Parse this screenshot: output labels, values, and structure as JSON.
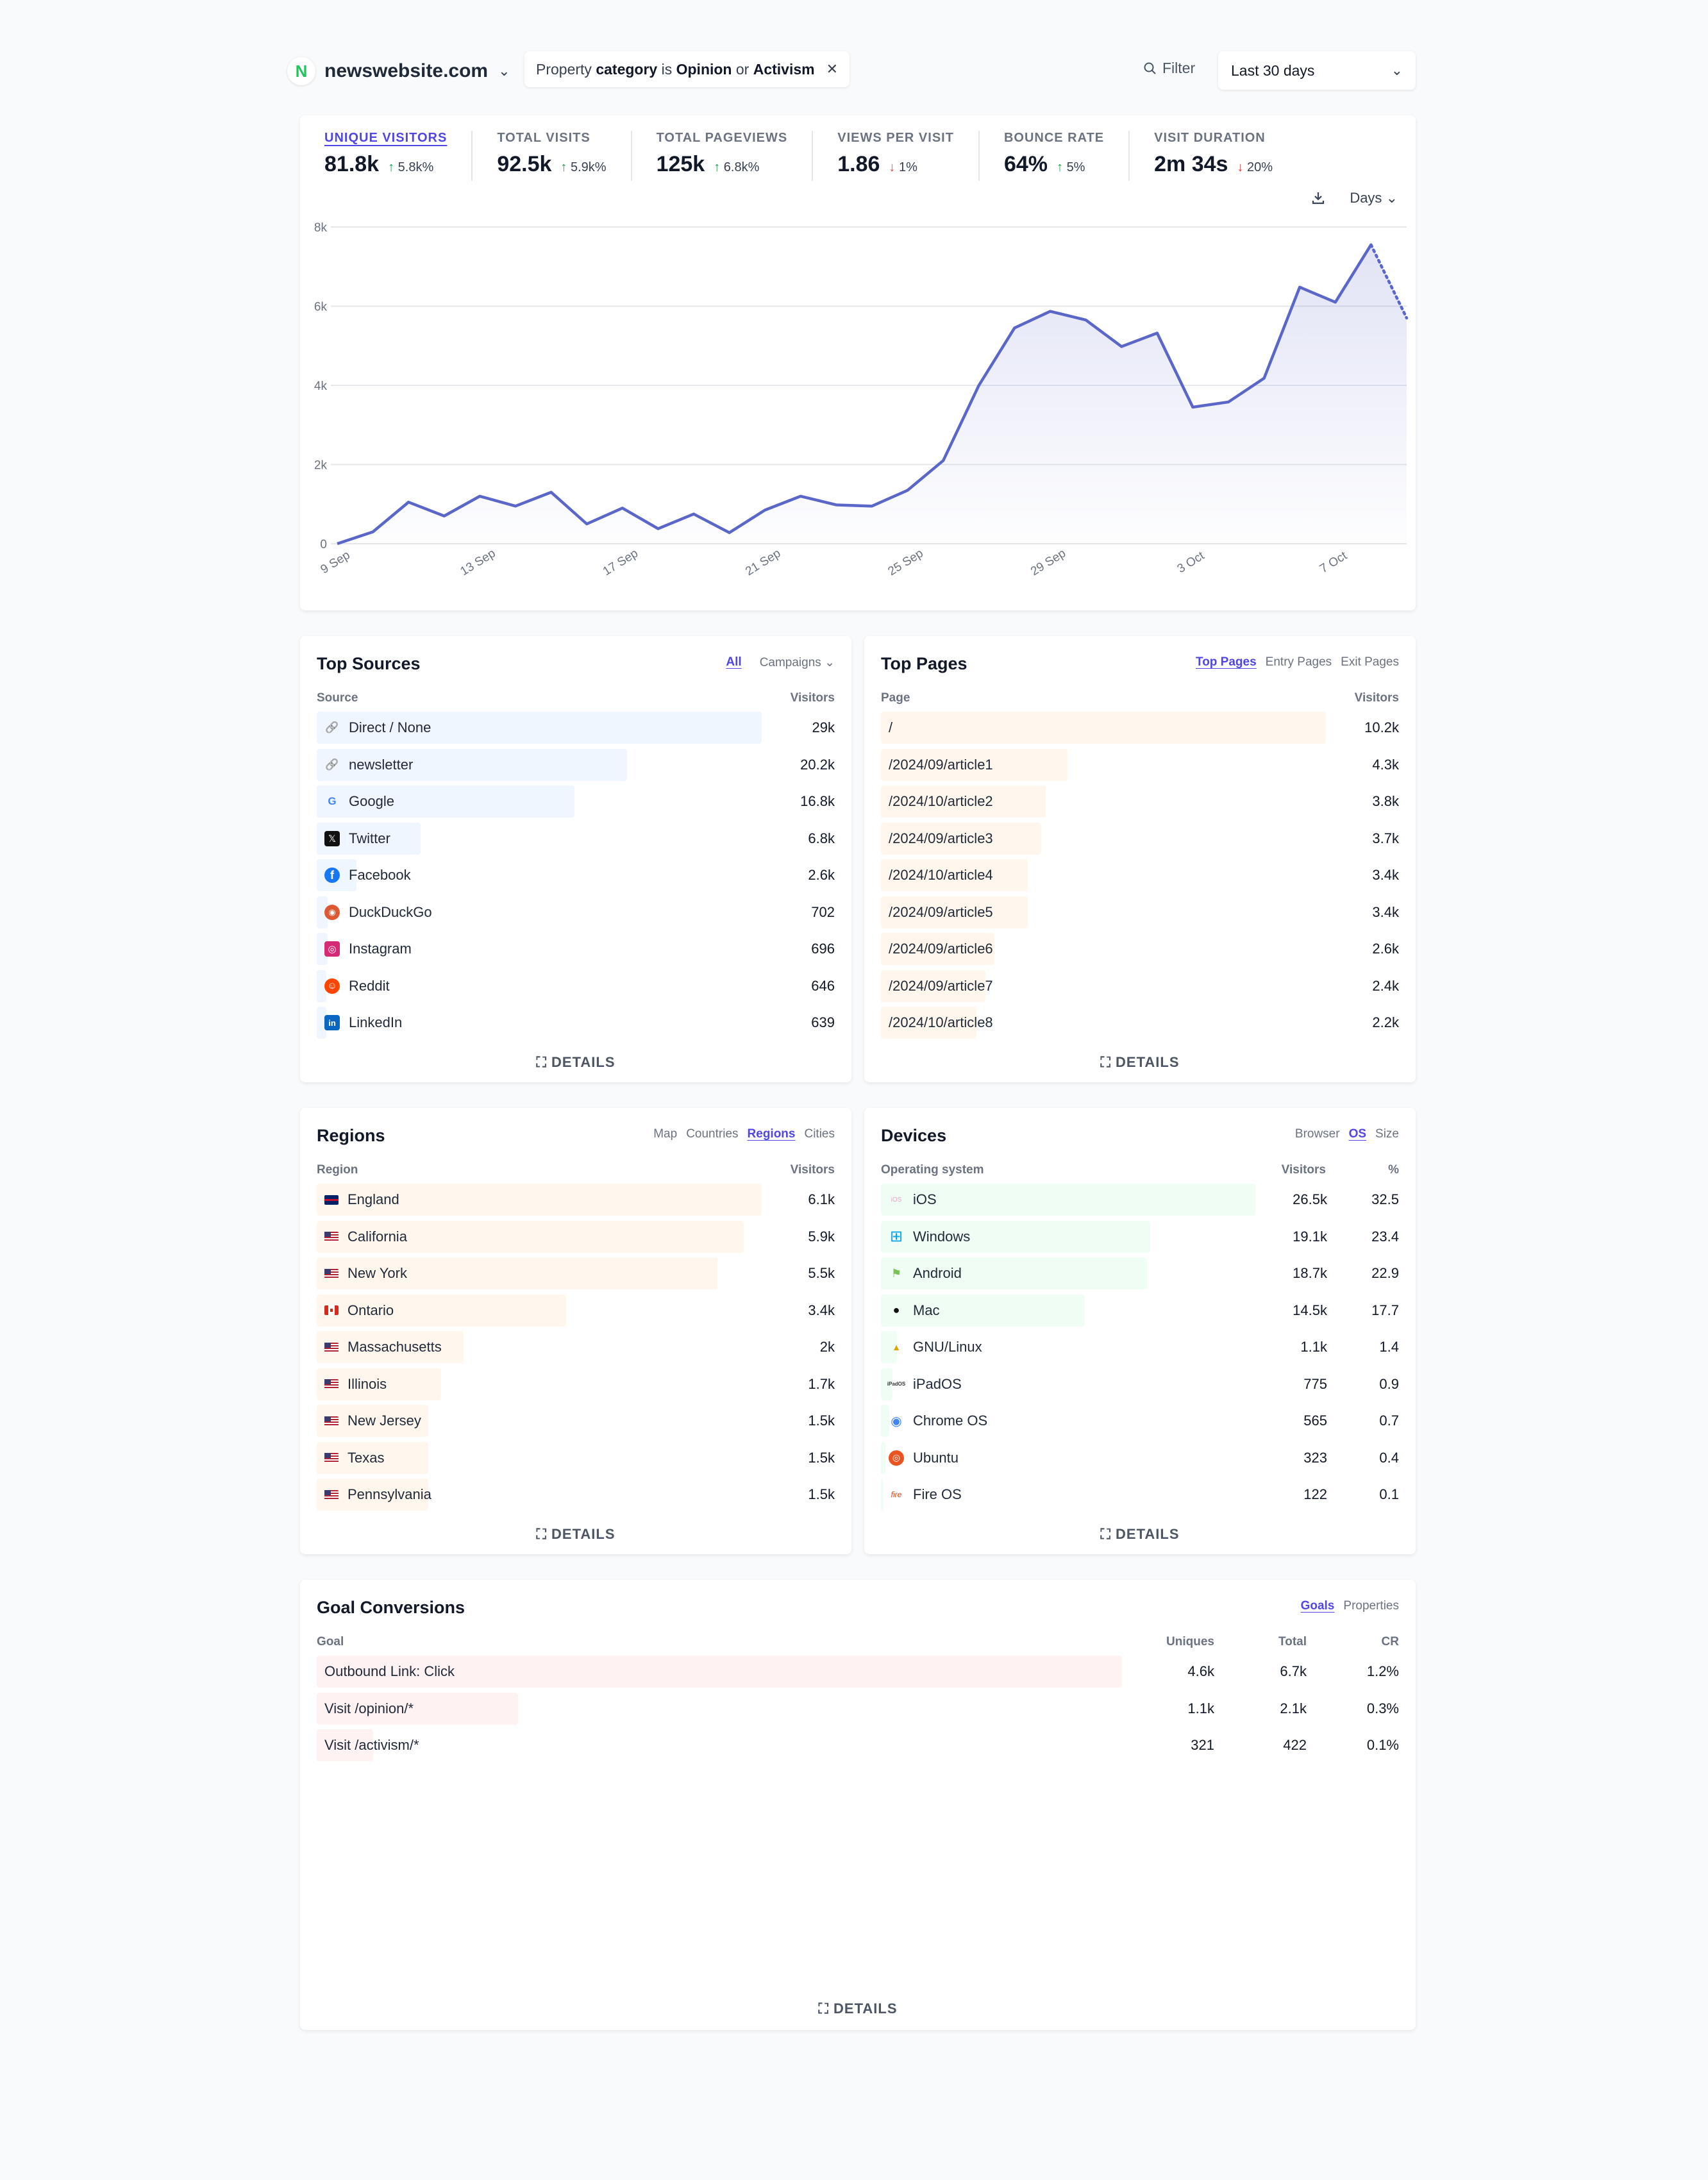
{
  "site": {
    "initial": "N",
    "domain": "newswebsite.com"
  },
  "filter": {
    "prefix": "Property",
    "property": "category",
    "verb": "is",
    "value1": "Opinion",
    "joiner": "or",
    "value2": "Activism"
  },
  "filter_button": "Filter",
  "period": "Last 30 days",
  "stats": [
    {
      "label": "UNIQUE VISITORS",
      "value": "81.8k",
      "change": "5.8k%",
      "dir": "up"
    },
    {
      "label": "TOTAL VISITS",
      "value": "92.5k",
      "change": "5.9k%",
      "dir": "up"
    },
    {
      "label": "TOTAL PAGEVIEWS",
      "value": "125k",
      "change": "6.8k%",
      "dir": "up"
    },
    {
      "label": "VIEWS PER VISIT",
      "value": "1.86",
      "change": "1%",
      "dir": "down"
    },
    {
      "label": "BOUNCE RATE",
      "value": "64%",
      "change": "5%",
      "dir": "up"
    },
    {
      "label": "VISIT DURATION",
      "value": "2m 34s",
      "change": "20%",
      "dir": "down"
    }
  ],
  "interval": "Days",
  "chart_data": {
    "type": "area",
    "ylim": [
      0,
      8000
    ],
    "yticks": [
      0,
      2000,
      4000,
      6000,
      8000
    ],
    "ytick_labels": [
      "0",
      "2k",
      "4k",
      "6k",
      "8k"
    ],
    "xtick_labels": [
      "9 Sep",
      "13 Sep",
      "17 Sep",
      "21 Sep",
      "25 Sep",
      "29 Sep",
      "3 Oct",
      "7 Oct"
    ],
    "x": [
      "9 Sep",
      "10 Sep",
      "11 Sep",
      "12 Sep",
      "13 Sep",
      "14 Sep",
      "15 Sep",
      "16 Sep",
      "17 Sep",
      "18 Sep",
      "19 Sep",
      "20 Sep",
      "21 Sep",
      "22 Sep",
      "23 Sep",
      "24 Sep",
      "25 Sep",
      "26 Sep",
      "27 Sep",
      "28 Sep",
      "29 Sep",
      "30 Sep",
      "1 Oct",
      "2 Oct",
      "3 Oct",
      "4 Oct",
      "5 Oct",
      "6 Oct",
      "7 Oct",
      "8 Oct",
      "9 Oct",
      "10 Oct"
    ],
    "series": [
      {
        "values": [
          0,
          300,
          1050,
          700,
          1200,
          950,
          1300,
          500,
          900,
          380,
          750,
          280,
          850,
          1200,
          980,
          950,
          1350,
          2100,
          4000,
          5450,
          5870,
          5650,
          4980,
          5320,
          3450,
          3580,
          4180,
          6480,
          6100,
          7550,
          5700
        ]
      }
    ],
    "grid": true,
    "color": "#5b66c9",
    "incomplete_last_segment": true
  },
  "top_sources": {
    "title": "Top Sources",
    "tabs": [
      "All",
      "Campaigns"
    ],
    "col_left": "Source",
    "col_right": "Visitors",
    "rows": [
      {
        "label": "Direct / None",
        "value": "29k",
        "frac": 1.0,
        "icon": "link-icon"
      },
      {
        "label": "newsletter",
        "value": "20.2k",
        "frac": 0.697,
        "icon": "link-icon"
      },
      {
        "label": "Google",
        "value": "16.8k",
        "frac": 0.579,
        "icon": "google-icon"
      },
      {
        "label": "Twitter",
        "value": "6.8k",
        "frac": 0.234,
        "icon": "x-icon"
      },
      {
        "label": "Facebook",
        "value": "2.6k",
        "frac": 0.09,
        "icon": "facebook-icon"
      },
      {
        "label": "DuckDuckGo",
        "value": "702",
        "frac": 0.024,
        "icon": "duckduckgo-icon"
      },
      {
        "label": "Instagram",
        "value": "696",
        "frac": 0.024,
        "icon": "instagram-icon"
      },
      {
        "label": "Reddit",
        "value": "646",
        "frac": 0.022,
        "icon": "reddit-icon"
      },
      {
        "label": "LinkedIn",
        "value": "639",
        "frac": 0.022,
        "icon": "linkedin-icon"
      }
    ],
    "details": "DETAILS"
  },
  "top_pages": {
    "title": "Top Pages",
    "tabs": [
      "Top Pages",
      "Entry Pages",
      "Exit Pages"
    ],
    "col_left": "Page",
    "col_right": "Visitors",
    "rows": [
      {
        "label": "/",
        "value": "10.2k",
        "frac": 1.0
      },
      {
        "label": "/2024/09/article1",
        "value": "4.3k",
        "frac": 0.42
      },
      {
        "label": "/2024/10/article2",
        "value": "3.8k",
        "frac": 0.37
      },
      {
        "label": "/2024/09/article3",
        "value": "3.7k",
        "frac": 0.36
      },
      {
        "label": "/2024/10/article4",
        "value": "3.4k",
        "frac": 0.33
      },
      {
        "label": "/2024/09/article5",
        "value": "3.4k",
        "frac": 0.33
      },
      {
        "label": "/2024/09/article6",
        "value": "2.6k",
        "frac": 0.255
      },
      {
        "label": "/2024/09/article7",
        "value": "2.4k",
        "frac": 0.235
      },
      {
        "label": "/2024/10/article8",
        "value": "2.2k",
        "frac": 0.215
      }
    ],
    "details": "DETAILS"
  },
  "regions": {
    "title": "Regions",
    "tabs": [
      "Map",
      "Countries",
      "Regions",
      "Cities"
    ],
    "col_left": "Region",
    "col_right": "Visitors",
    "rows": [
      {
        "label": "England",
        "value": "6.1k",
        "frac": 1.0,
        "flag": "gb"
      },
      {
        "label": "California",
        "value": "5.9k",
        "frac": 0.96,
        "flag": "us"
      },
      {
        "label": "New York",
        "value": "5.5k",
        "frac": 0.9,
        "flag": "us"
      },
      {
        "label": "Ontario",
        "value": "3.4k",
        "frac": 0.56,
        "flag": "ca"
      },
      {
        "label": "Massachusetts",
        "value": "2k",
        "frac": 0.33,
        "flag": "us"
      },
      {
        "label": "Illinois",
        "value": "1.7k",
        "frac": 0.28,
        "flag": "us"
      },
      {
        "label": "New Jersey",
        "value": "1.5k",
        "frac": 0.25,
        "flag": "us"
      },
      {
        "label": "Texas",
        "value": "1.5k",
        "frac": 0.25,
        "flag": "us"
      },
      {
        "label": "Pennsylvania",
        "value": "1.5k",
        "frac": 0.25,
        "flag": "us"
      }
    ],
    "details": "DETAILS"
  },
  "devices": {
    "title": "Devices",
    "tabs": [
      "Browser",
      "OS",
      "Size"
    ],
    "col_left": "Operating system",
    "col_mid": "Visitors",
    "col_right": "%",
    "rows": [
      {
        "label": "iOS",
        "value": "26.5k",
        "pct": "32.5",
        "frac": 1.0,
        "icon": "ios-icon"
      },
      {
        "label": "Windows",
        "value": "19.1k",
        "pct": "23.4",
        "frac": 0.72,
        "icon": "windows-icon"
      },
      {
        "label": "Android",
        "value": "18.7k",
        "pct": "22.9",
        "frac": 0.71,
        "icon": "android-icon"
      },
      {
        "label": "Mac",
        "value": "14.5k",
        "pct": "17.7",
        "frac": 0.545,
        "icon": "apple-icon"
      },
      {
        "label": "GNU/Linux",
        "value": "1.1k",
        "pct": "1.4",
        "frac": 0.042,
        "icon": "linux-icon"
      },
      {
        "label": "iPadOS",
        "value": "775",
        "pct": "0.9",
        "frac": 0.03,
        "icon": "ipados-icon"
      },
      {
        "label": "Chrome OS",
        "value": "565",
        "pct": "0.7",
        "frac": 0.022,
        "icon": "chrome-icon"
      },
      {
        "label": "Ubuntu",
        "value": "323",
        "pct": "0.4",
        "frac": 0.012,
        "icon": "ubuntu-icon"
      },
      {
        "label": "Fire OS",
        "value": "122",
        "pct": "0.1",
        "frac": 0.005,
        "icon": "fire-icon"
      }
    ],
    "details": "DETAILS"
  },
  "goals": {
    "title": "Goal Conversions",
    "tabs": [
      "Goals",
      "Properties"
    ],
    "col_left": "Goal",
    "col_uniques": "Uniques",
    "col_total": "Total",
    "col_cr": "CR",
    "rows": [
      {
        "label": "Outbound Link: Click",
        "uniques": "4.6k",
        "total": "6.7k",
        "cr": "1.2%",
        "frac": 1.0
      },
      {
        "label": "Visit /opinion/*",
        "uniques": "1.1k",
        "total": "2.1k",
        "cr": "0.3%",
        "frac": 0.25
      },
      {
        "label": "Visit /activism/*",
        "uniques": "321",
        "total": "422",
        "cr": "0.1%",
        "frac": 0.07
      }
    ],
    "details": "DETAILS"
  },
  "colors": {
    "accent": "#4f46e5",
    "line": "#5b66c9",
    "sources_bar": "#eff6ff",
    "pages_bar": "#fff7ed",
    "regions_bar": "#fff7ed",
    "devices_bar": "#f0fdf4",
    "goals_bar": "#fef2f2"
  }
}
